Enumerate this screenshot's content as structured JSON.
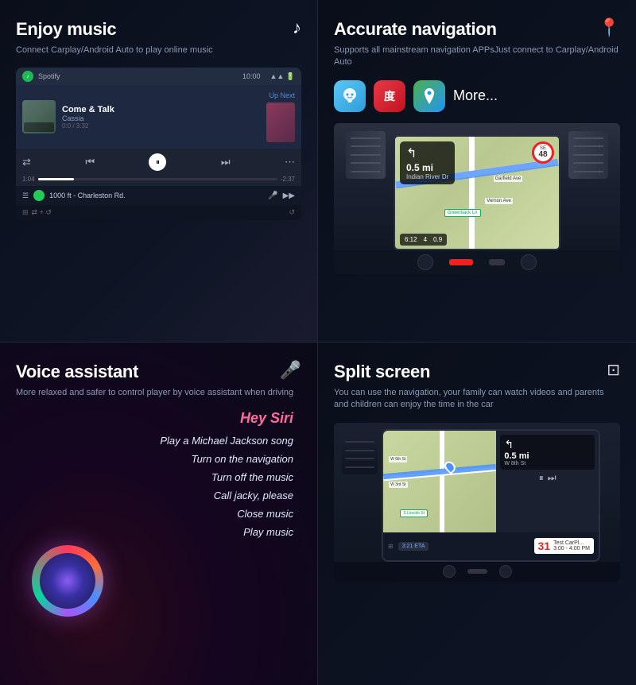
{
  "music": {
    "title": "Enjoy music",
    "subtitle": "Connect Carplay/Android Auto to play online music",
    "icon": "♪",
    "player": {
      "app": "Spotify",
      "time": "10:00",
      "song_title": "Come & Talk",
      "artist": "Cassia",
      "progress": "0:0 / 3:32",
      "up_next": "Up Next",
      "bar1_time": "1:04",
      "bar2_time": "-2:37",
      "nav_route": "1000 ft - Charleston Rd."
    }
  },
  "navigation": {
    "title": "Accurate navigation",
    "subtitle": "Supports all mainstream navigation APPsJust connect to Carplay/Android Auto",
    "icon": "📍",
    "apps_more": "More...",
    "map": {
      "distance": "0.5 mi",
      "street": "Indian River Dr",
      "eta_time": "6:12",
      "eta_min": "4",
      "eta_dist": "0.9",
      "speed_limit": "48"
    }
  },
  "voice": {
    "title": "Voice assistant",
    "subtitle": "More relaxed and safer to control player by voice assistant when driving",
    "icon": "🎤",
    "commands": [
      "Hey Siri",
      "Play a Michael Jackson song",
      "Turn on the navigation",
      "Turn off the music",
      "Call jacky, please",
      "Close music",
      "Play music"
    ]
  },
  "split": {
    "title": "Split screen",
    "subtitle": "You can use the navigation, your family can watch videos and parents and children can enjoy the time in the car",
    "icon": "⊡",
    "map": {
      "distance": "0.5 mi",
      "street": "W 8th St",
      "eta": "3:21 ETA"
    },
    "media": {
      "title": "Test CarPl...",
      "time": "3:00 - 4:00 PM"
    },
    "calendar_day": "31"
  }
}
